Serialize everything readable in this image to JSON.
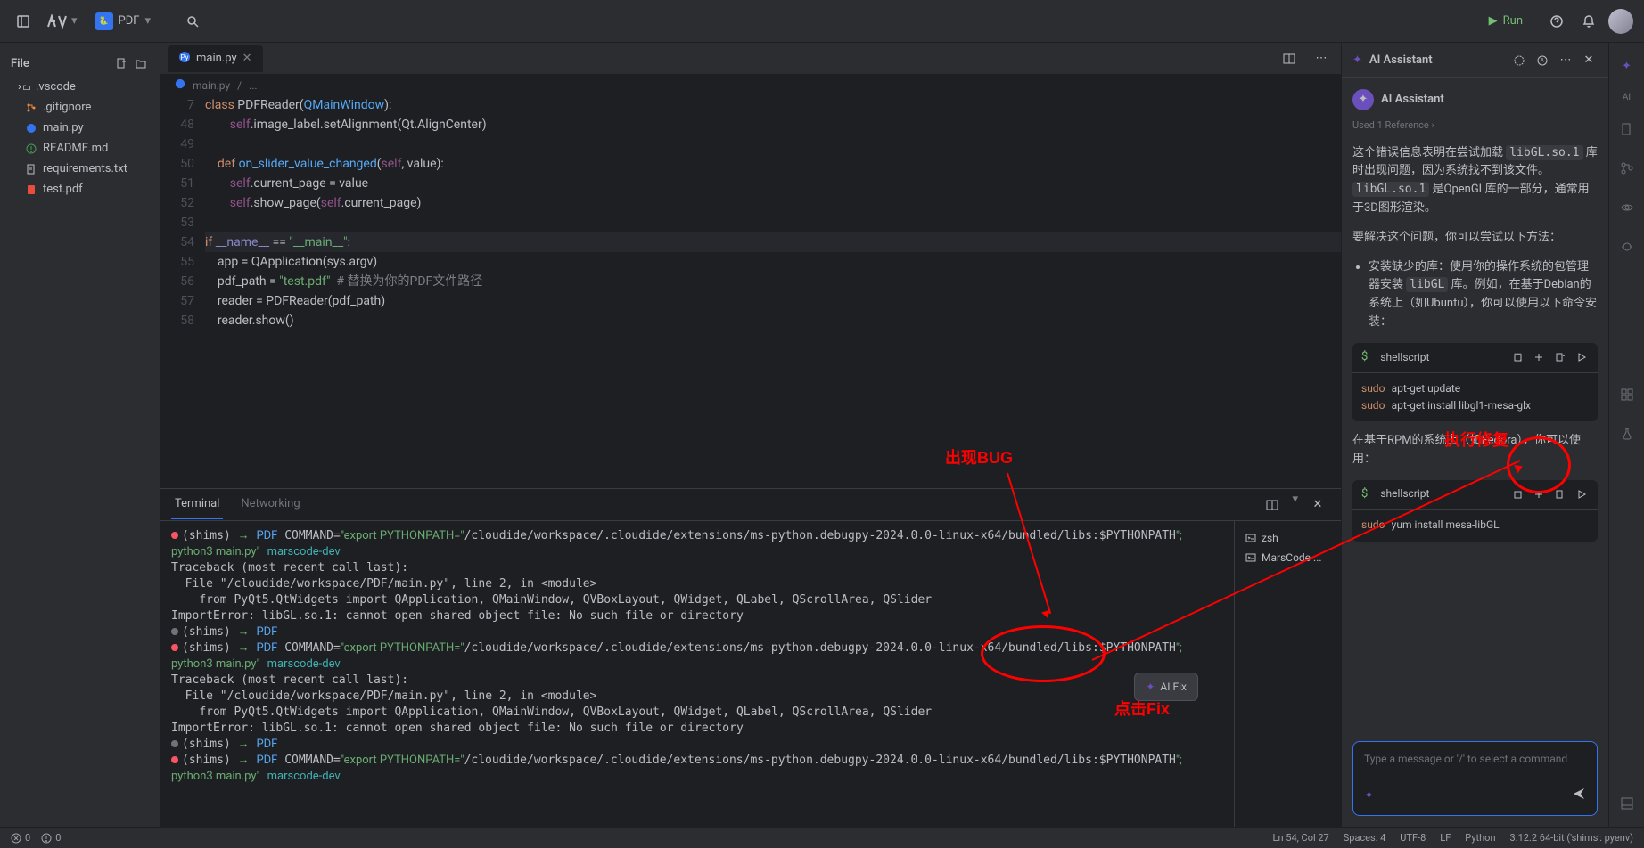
{
  "topbar": {
    "pdf_label": "PDF",
    "run_label": "Run"
  },
  "file_sidebar": {
    "header": "File",
    "items": [
      {
        "name": ".vscode",
        "type": "folder"
      },
      {
        "name": ".gitignore",
        "type": "git"
      },
      {
        "name": "main.py",
        "type": "py"
      },
      {
        "name": "README.md",
        "type": "md"
      },
      {
        "name": "requirements.txt",
        "type": "txt"
      },
      {
        "name": "test.pdf",
        "type": "pdf"
      }
    ]
  },
  "editor": {
    "tab_name": "main.py",
    "breadcrumb_file": "main.py",
    "breadcrumb_rest": "...",
    "lines": [
      {
        "num": "7",
        "html": "<span class='kw'>class</span> <span class='cls'>PDFReader</span>(<span class='fn'>QMainWindow</span>):"
      },
      {
        "num": "48",
        "html": "        <span class='self'>self</span>.image_label.setAlignment(Qt.AlignCenter)"
      },
      {
        "num": "49",
        "html": ""
      },
      {
        "num": "50",
        "html": "    <span class='kw'>def</span> <span class='fn'>on_slider_value_changed</span>(<span class='self'>self</span>, value):"
      },
      {
        "num": "51",
        "html": "        <span class='self'>self</span>.current_page = value"
      },
      {
        "num": "52",
        "html": "        <span class='self'>self</span>.show_page(<span class='self'>self</span>.current_page)"
      },
      {
        "num": "53",
        "html": ""
      },
      {
        "num": "54",
        "html": "<span class='kw'>if</span> <span class='builtin'>__name__</span> == <span class='str'>\"__main__\"</span>:",
        "hl": true
      },
      {
        "num": "55",
        "html": "    app = QApplication(sys.argv)"
      },
      {
        "num": "56",
        "html": "    pdf_path = <span class='str'>\"test.pdf\"</span>  <span class='cmt'># 替换为你的PDF文件路径</span>"
      },
      {
        "num": "57",
        "html": "    reader = PDFReader(pdf_path)"
      },
      {
        "num": "58",
        "html": "    reader.show()"
      }
    ]
  },
  "terminal": {
    "tab_terminal": "Terminal",
    "tab_networking": "Networking",
    "sessions": [
      {
        "name": "zsh"
      },
      {
        "name": "MarsCode ..."
      }
    ],
    "ai_fix_label": "AI Fix",
    "output_html": "<span class='dot-red'></span>(shims) <span class='term-green'>→</span> <span class='term-blue'>PDF</span> COMMAND=<span class='term-cmd'>\"export PYTHONPATH=\"</span>/cloudide/workspace/.cloudide/extensions/ms-python.debugpy-2024.0.0-linux-x64/bundled/libs:$PYTHONPATH<span class='term-cmd'>\"; python3 main.py\"</span> <span class='term-dev'>marscode-dev</span>\nTraceback (most recent call last):\n  File \"/cloudide/workspace/PDF/main.py\", line 2, in &lt;module&gt;\n    from PyQt5.QtWidgets import QApplication, QMainWindow, QVBoxLayout, QWidget, QLabel, QScrollArea, QSlider\nImportError: libGL.so.1: cannot open shared object file: No such file or directory\n<span class='dot-gray'></span>(shims) <span class='term-green'>→</span> <span class='term-blue'>PDF</span>\n<span class='dot-red'></span>(shims) <span class='term-green'>→</span> <span class='term-blue'>PDF</span> COMMAND=<span class='term-cmd'>\"export PYTHONPATH=\"</span>/cloudide/workspace/.cloudide/extensions/ms-python.debugpy-2024.0.0-linux-x64/bundled/libs:$PYTHONPATH<span class='term-cmd'>\"; python3 main.py\"</span> <span class='term-dev'>marscode-dev</span>\nTraceback (most recent call last):\n  File \"/cloudide/workspace/PDF/main.py\", line 2, in &lt;module&gt;\n    from PyQt5.QtWidgets import QApplication, QMainWindow, QVBoxLayout, QWidget, QLabel, QScrollArea, QSlider\nImportError: libGL.so.1: cannot open shared object file: No such file or directory\n<span class='dot-gray'></span>(shims) <span class='term-green'>→</span> <span class='term-blue'>PDF</span>\n<span class='dot-red'></span>(shims) <span class='term-green'>→</span> <span class='term-blue'>PDF</span> COMMAND=<span class='term-cmd'>\"export PYTHONPATH=\"</span>/cloudide/workspace/.cloudide/extensions/ms-python.debugpy-2024.0.0-linux-x64/bundled/libs:$PYTHONPATH<span class='term-cmd'>\"; python3 main.py\"</span> <span class='term-dev'>marscode-dev</span>"
  },
  "ai_panel": {
    "title": "AI Assistant",
    "assistant_name": "AI Assistant",
    "reference": "Used 1 Reference",
    "msg1": "这个错误信息表明在尝试加载 <span class='code-hl'>libGL.so.1</span> 库时出现问题，因为系统找不到该文件。<span class='code-hl'>libGL.so.1</span> 是OpenGL库的一部分，通常用于3D图形渲染。",
    "msg2": "要解决这个问题，你可以尝试以下方法：",
    "msg3": "安装缺少的库：使用你的操作系统的包管理器安装 <span class='code-hl'>libGL</span> 库。例如，在基于Debian的系统上（如Ubuntu），你可以使用以下命令安装：",
    "code1_lang": "shellscript",
    "code1_body": "<span class='sh-cmd'>sudo</span> <span class='sh-arg'>apt-get update</span>\n<span class='sh-cmd'>sudo</span> <span class='sh-arg'>apt-get install libgl1-mesa-glx</span>",
    "msg4": "在基于RPM的系统上（如Fedora），你可以使用：",
    "code2_lang": "shellscript",
    "code2_body": "<span class='sh-cmd'>sudo</span> <span class='sh-arg'>yum install mesa-libGL</span>",
    "input_placeholder": "Type a message or '/' to select a command"
  },
  "right_rail": {
    "ai_label": "AI"
  },
  "statusbar": {
    "errors": "0",
    "warnings": "0",
    "cursor": "Ln 54, Col 27",
    "spaces": "Spaces: 4",
    "encoding": "UTF-8",
    "eol": "LF",
    "language": "Python",
    "interpreter": "3.12.2 64-bit ('shims': pyenv)"
  },
  "annotations": {
    "bug": "出现BUG",
    "fix": "点击Fix",
    "exec": "执行修复"
  }
}
